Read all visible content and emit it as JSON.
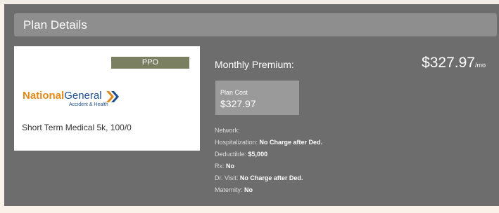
{
  "header": {
    "title": "Plan Details"
  },
  "plan_card": {
    "badge": "PPO",
    "logo": {
      "word1": "National",
      "word2": "General",
      "subtitle": "Accident & Health"
    },
    "plan_name": "Short Term Medical 5k, 100/0"
  },
  "premium": {
    "label": "Monthly Premium:",
    "amount": "$327.97",
    "unit": "/mo"
  },
  "plan_cost": {
    "label": "Plan Cost",
    "value": "$327.97"
  },
  "details": [
    {
      "label": "Network:",
      "value": ""
    },
    {
      "label": "Hospitalization:",
      "value": "No Charge after Ded."
    },
    {
      "label": "Deductible:",
      "value": "$5,000"
    },
    {
      "label": "Rx:",
      "value": "No"
    },
    {
      "label": "Dr. Visit:",
      "value": "No Charge after Ded."
    },
    {
      "label": "Maternity:",
      "value": "No"
    }
  ],
  "colors": {
    "panel": "#6d6d6d",
    "header_bar": "#8e8e8e",
    "badge": "#7b7f62",
    "brand_orange": "#e48a1b",
    "brand_blue": "#1f4f8f"
  }
}
